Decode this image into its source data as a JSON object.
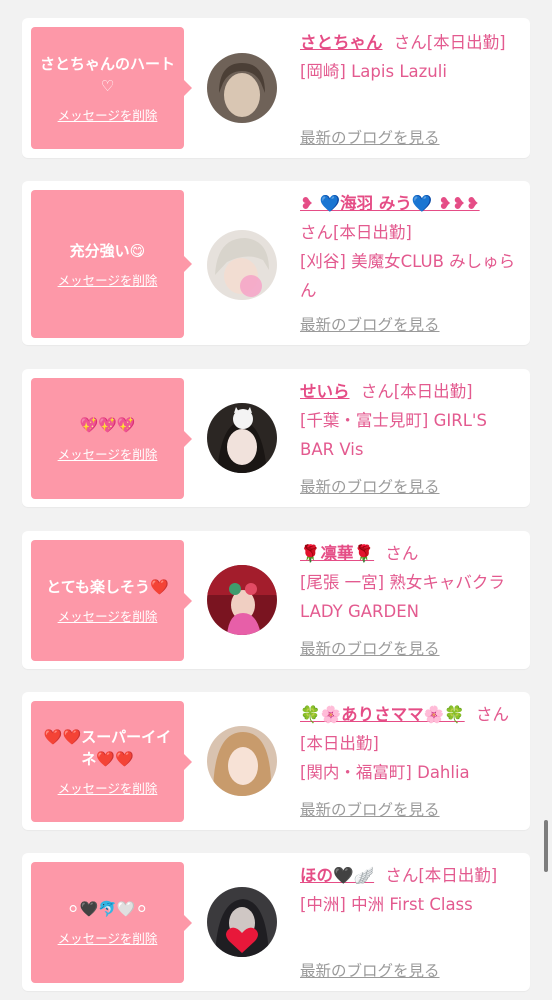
{
  "colors": {
    "bubble": "#fd98a8",
    "accent": "#e54d86",
    "link_grey": "#9a9a9a",
    "background": "#f2f2f2"
  },
  "delete_label": "メッセージを削除",
  "blog_label": "最新のブログを見る",
  "cards": [
    {
      "message": "さとちゃんのハート♡",
      "name": "さとちゃん",
      "san": "さん[本日出勤]",
      "shop": "[岡崎] Lapis Lazuli",
      "avatar_icon": "avatar-photo"
    },
    {
      "message": "充分強い😋",
      "name": "❥ 💙海羽 みう💙 ❥❥❥",
      "san": "さん[本日出勤]",
      "shop": "[刈谷] 美魔女CLUB みしゅらん",
      "avatar_icon": "avatar-photo"
    },
    {
      "message": "💖💖💖",
      "name": "せいら",
      "san": "さん[本日出勤]",
      "shop": "[千葉・富士見町] GIRL'S BAR Vis",
      "avatar_icon": "avatar-photo"
    },
    {
      "message": "とても楽しそう❤️",
      "name": "🌹凛華🌹",
      "san": "さん",
      "shop": "[尾張 一宮] 熟女キャバクラ LADY GARDEN",
      "avatar_icon": "avatar-photo"
    },
    {
      "message": "❤️❤️スーパーイイネ❤️❤️",
      "name": "🍀🌸ありさママ🌸🍀",
      "san": "さん[本日出勤]",
      "shop": "[関内・福富町] Dahlia",
      "avatar_icon": "avatar-photo"
    },
    {
      "message": "⚪︎🖤🐬🤍⚪︎",
      "name": "ほの🖤🪽",
      "san": "さん[本日出勤]",
      "shop": "[中洲] 中洲 First Class",
      "avatar_icon": "avatar-photo"
    }
  ]
}
